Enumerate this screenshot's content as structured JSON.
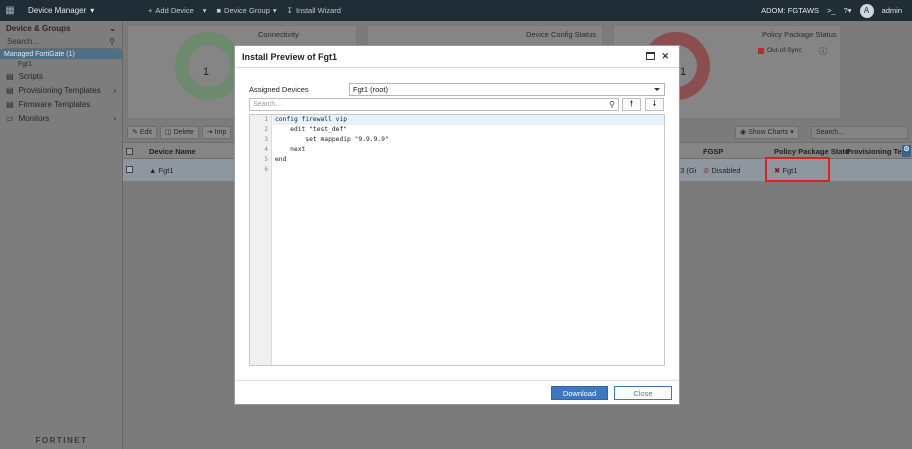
{
  "topbar": {
    "module": "Device Manager",
    "add_device": "Add Device",
    "device_group": "Device Group",
    "install_wizard": "Install Wizard",
    "adom": "ADOM: FGTAWS",
    "user": "admin",
    "avatar_letter": "A"
  },
  "sidebar": {
    "header": "Device & Groups",
    "search_placeholder": "Search...",
    "selected_group": "Managed FortiGate (1)",
    "sub_item": "Fgt1",
    "items": [
      {
        "label": "Scripts"
      },
      {
        "label": "Provisioning Templates"
      },
      {
        "label": "Firmware Templates"
      },
      {
        "label": "Monitors"
      }
    ],
    "brand": "FORTINET"
  },
  "dashboard": {
    "connectivity": {
      "title": "Connectivity",
      "value": "1"
    },
    "config_status": {
      "title": "Device Config Status"
    },
    "policy_status": {
      "title": "Policy Package Status",
      "value": "1",
      "legend": "Out-of-Sync"
    }
  },
  "toolbar": {
    "edit": "Edit",
    "delete": "Delete",
    "import_stub": "Imp",
    "show_charts": "Show Charts",
    "search_placeholder": "Search..."
  },
  "table": {
    "columns": {
      "device_name": "Device Name",
      "fgsp": "FGSP",
      "policy_package_status": "Policy Package Statu",
      "provisioning_templates": "Provisioning Tem"
    },
    "rows": [
      {
        "device_name": "Fgt1",
        "partial_ip": "23 (Gi",
        "fgsp": "Disabled",
        "policy_package_status": "Fgt1"
      }
    ]
  },
  "modal": {
    "title": "Install Preview of Fgt1",
    "assigned_devices_label": "Assigned Devices",
    "assigned_devices_value": "Fgt1 (root)",
    "search_placeholder": "Search...",
    "code_lines": [
      {
        "n": "1",
        "text": "config firewall vip"
      },
      {
        "n": "2",
        "text": "    edit \"test_def\""
      },
      {
        "n": "3",
        "text": "        set mappedip \"9.9.9.9\""
      },
      {
        "n": "4",
        "text": "    next"
      },
      {
        "n": "5",
        "text": "end"
      },
      {
        "n": "6",
        "text": ""
      }
    ],
    "download_label": "Download",
    "close_label": "Close"
  },
  "colors": {
    "accent": "#3a79c1",
    "highlight_box": "#e0201a",
    "topbar": "#1e2d36"
  }
}
